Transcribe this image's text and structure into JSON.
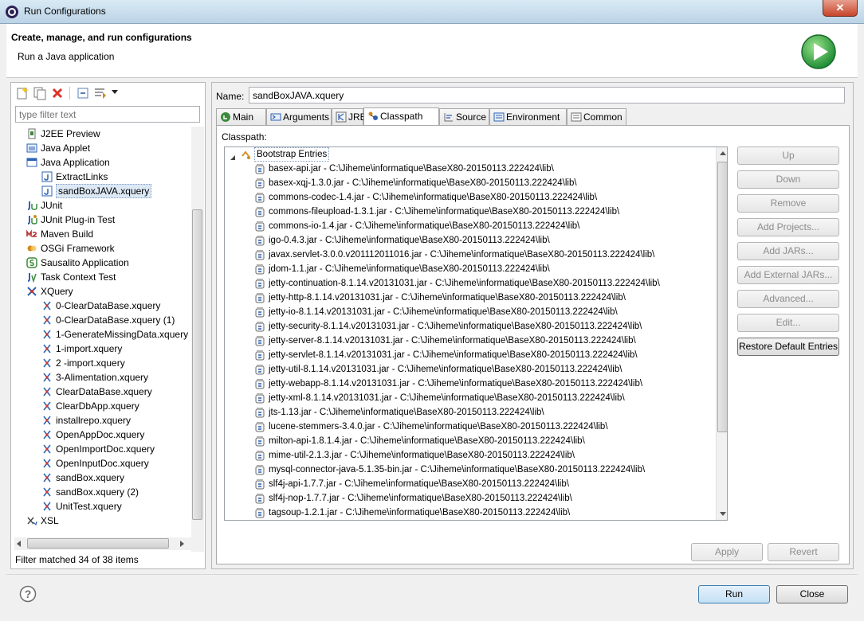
{
  "window": {
    "title": "Run Configurations",
    "close_label": "✕"
  },
  "header": {
    "title": "Create, manage, and run configurations",
    "subtitle": "Run a Java application"
  },
  "left": {
    "filter_placeholder": "type filter text",
    "status": "Filter matched 34 of 38 items",
    "tree": [
      {
        "label": "J2EE Preview",
        "icon": "j2ee-icon",
        "indent": 0
      },
      {
        "label": "Java Applet",
        "icon": "applet-icon",
        "indent": 0
      },
      {
        "label": "Java Application",
        "icon": "java-app-icon",
        "indent": 0
      },
      {
        "label": "ExtractLinks",
        "icon": "java-config-icon",
        "indent": 1
      },
      {
        "label": "sandBoxJAVA.xquery",
        "icon": "java-config-icon",
        "indent": 1,
        "selected": true
      },
      {
        "label": "JUnit",
        "icon": "junit-icon",
        "indent": 0
      },
      {
        "label": "JUnit Plug-in Test",
        "icon": "junit-plugin-icon",
        "indent": 0
      },
      {
        "label": "Maven Build",
        "icon": "maven-icon",
        "indent": 0
      },
      {
        "label": "OSGi Framework",
        "icon": "osgi-icon",
        "indent": 0
      },
      {
        "label": "Sausalito Application",
        "icon": "sausalito-icon",
        "indent": 0
      },
      {
        "label": "Task Context Test",
        "icon": "task-context-icon",
        "indent": 0
      },
      {
        "label": "XQuery",
        "icon": "xquery-icon",
        "indent": 0
      },
      {
        "label": "0-ClearDataBase.xquery",
        "icon": "xquery-file-icon",
        "indent": 1
      },
      {
        "label": "0-ClearDataBase.xquery (1)",
        "icon": "xquery-file-icon",
        "indent": 1
      },
      {
        "label": "1-GenerateMissingData.xquery",
        "icon": "xquery-file-icon",
        "indent": 1
      },
      {
        "label": "1-import.xquery",
        "icon": "xquery-file-icon",
        "indent": 1
      },
      {
        "label": "2 -import.xquery",
        "icon": "xquery-file-icon",
        "indent": 1
      },
      {
        "label": "3-Alimentation.xquery",
        "icon": "xquery-file-icon",
        "indent": 1
      },
      {
        "label": "ClearDataBase.xquery",
        "icon": "xquery-file-icon",
        "indent": 1
      },
      {
        "label": "ClearDbApp.xquery",
        "icon": "xquery-file-icon",
        "indent": 1
      },
      {
        "label": "installrepo.xquery",
        "icon": "xquery-file-icon",
        "indent": 1
      },
      {
        "label": "OpenAppDoc.xquery",
        "icon": "xquery-file-icon",
        "indent": 1
      },
      {
        "label": "OpenImportDoc.xquery",
        "icon": "xquery-file-icon",
        "indent": 1
      },
      {
        "label": "OpenInputDoc.xquery",
        "icon": "xquery-file-icon",
        "indent": 1
      },
      {
        "label": "sandBox.xquery",
        "icon": "xquery-file-icon",
        "indent": 1
      },
      {
        "label": "sandBox.xquery (2)",
        "icon": "xquery-file-icon",
        "indent": 1
      },
      {
        "label": "UnitTest.xquery",
        "icon": "xquery-file-icon",
        "indent": 1
      },
      {
        "label": "XSL",
        "icon": "xsl-icon",
        "indent": 0
      }
    ]
  },
  "config": {
    "name_label": "Name:",
    "name_value": "sandBoxJAVA.xquery",
    "tabs": [
      {
        "label": "Main",
        "icon": "main-tab-icon"
      },
      {
        "label": "Arguments",
        "icon": "arguments-tab-icon"
      },
      {
        "label": "JRE",
        "icon": "jre-tab-icon"
      },
      {
        "label": "Classpath",
        "icon": "classpath-tab-icon",
        "active": true
      },
      {
        "label": "Source",
        "icon": "source-tab-icon"
      },
      {
        "label": "Environment",
        "icon": "environment-tab-icon"
      },
      {
        "label": "Common",
        "icon": "common-tab-icon"
      }
    ],
    "classpath_label": "Classpath:",
    "bootstrap_label": "Bootstrap Entries",
    "entries": [
      "basex-api.jar - C:\\Jiheme\\informatique\\BaseX80-20150113.222424\\lib\\",
      "basex-xqj-1.3.0.jar - C:\\Jiheme\\informatique\\BaseX80-20150113.222424\\lib\\",
      "commons-codec-1.4.jar - C:\\Jiheme\\informatique\\BaseX80-20150113.222424\\lib\\",
      "commons-fileupload-1.3.1.jar - C:\\Jiheme\\informatique\\BaseX80-20150113.222424\\lib\\",
      "commons-io-1.4.jar - C:\\Jiheme\\informatique\\BaseX80-20150113.222424\\lib\\",
      "igo-0.4.3.jar - C:\\Jiheme\\informatique\\BaseX80-20150113.222424\\lib\\",
      "javax.servlet-3.0.0.v201112011016.jar - C:\\Jiheme\\informatique\\BaseX80-20150113.222424\\lib\\",
      "jdom-1.1.jar - C:\\Jiheme\\informatique\\BaseX80-20150113.222424\\lib\\",
      "jetty-continuation-8.1.14.v20131031.jar - C:\\Jiheme\\informatique\\BaseX80-20150113.222424\\lib\\",
      "jetty-http-8.1.14.v20131031.jar - C:\\Jiheme\\informatique\\BaseX80-20150113.222424\\lib\\",
      "jetty-io-8.1.14.v20131031.jar - C:\\Jiheme\\informatique\\BaseX80-20150113.222424\\lib\\",
      "jetty-security-8.1.14.v20131031.jar - C:\\Jiheme\\informatique\\BaseX80-20150113.222424\\lib\\",
      "jetty-server-8.1.14.v20131031.jar - C:\\Jiheme\\informatique\\BaseX80-20150113.222424\\lib\\",
      "jetty-servlet-8.1.14.v20131031.jar - C:\\Jiheme\\informatique\\BaseX80-20150113.222424\\lib\\",
      "jetty-util-8.1.14.v20131031.jar - C:\\Jiheme\\informatique\\BaseX80-20150113.222424\\lib\\",
      "jetty-webapp-8.1.14.v20131031.jar - C:\\Jiheme\\informatique\\BaseX80-20150113.222424\\lib\\",
      "jetty-xml-8.1.14.v20131031.jar - C:\\Jiheme\\informatique\\BaseX80-20150113.222424\\lib\\",
      "jts-1.13.jar - C:\\Jiheme\\informatique\\BaseX80-20150113.222424\\lib\\",
      "lucene-stemmers-3.4.0.jar - C:\\Jiheme\\informatique\\BaseX80-20150113.222424\\lib\\",
      "milton-api-1.8.1.4.jar - C:\\Jiheme\\informatique\\BaseX80-20150113.222424\\lib\\",
      "mime-util-2.1.3.jar - C:\\Jiheme\\informatique\\BaseX80-20150113.222424\\lib\\",
      "mysql-connector-java-5.1.35-bin.jar - C:\\Jiheme\\informatique\\BaseX80-20150113.222424\\lib\\",
      "slf4j-api-1.7.7.jar - C:\\Jiheme\\informatique\\BaseX80-20150113.222424\\lib\\",
      "slf4j-nop-1.7.7.jar - C:\\Jiheme\\informatique\\BaseX80-20150113.222424\\lib\\",
      "tagsoup-1.2.1.jar - C:\\Jiheme\\informatique\\BaseX80-20150113.222424\\lib\\"
    ],
    "side_buttons": [
      {
        "label": "Up",
        "enabled": false
      },
      {
        "label": "Down",
        "enabled": false
      },
      {
        "label": "Remove",
        "enabled": false
      },
      {
        "label": "Add Projects...",
        "enabled": false
      },
      {
        "label": "Add JARs...",
        "enabled": false
      },
      {
        "label": "Add External JARs...",
        "enabled": false
      },
      {
        "label": "Advanced...",
        "enabled": false
      },
      {
        "label": "Edit...",
        "enabled": false
      },
      {
        "label": "Restore Default Entries",
        "enabled": true
      }
    ],
    "apply_label": "Apply",
    "revert_label": "Revert"
  },
  "footer": {
    "run_label": "Run",
    "close_label": "Close"
  },
  "colors": {
    "run_green": "#2fa84f",
    "error_red": "#d9342b",
    "jar_blue": "#2d62b4"
  }
}
